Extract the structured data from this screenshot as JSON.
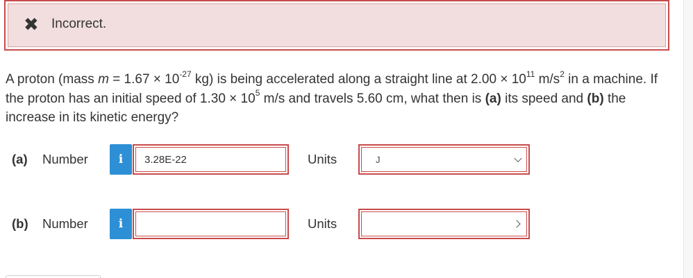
{
  "alert": {
    "icon": "✖",
    "icon_name": "x-mark-icon",
    "text": "Incorrect."
  },
  "question": {
    "t1": "A proton (mass ",
    "mvar": "m",
    "t2": " = 1.67 × 10",
    "exp1": "-27",
    "t3": " kg) is being accelerated along a straight line at 2.00 × 10",
    "exp2": "11",
    "t4": " m/s",
    "exp3": "2",
    "t5": " in a machine. If the proton has an initial speed of 1.30 × 10",
    "exp4": "5",
    "t6": " m/s and travels 5.60 cm, what then is ",
    "pa": "(a)",
    "t7": " its speed and ",
    "pb": "(b)",
    "t8": " the increase in its kinetic energy?"
  },
  "part_a": {
    "label": "(a)",
    "number_label": "Number",
    "info_icon": "i",
    "value": "3.28E-22",
    "units_label": "Units",
    "units_value": "J"
  },
  "part_b": {
    "label": "(b)",
    "number_label": "Number",
    "info_icon": "i",
    "value": "",
    "units_label": "Units",
    "units_value": ""
  },
  "colors": {
    "error_border": "#c94a4a",
    "alert_bg": "#f2dede",
    "info_button": "#2d8fd5"
  }
}
